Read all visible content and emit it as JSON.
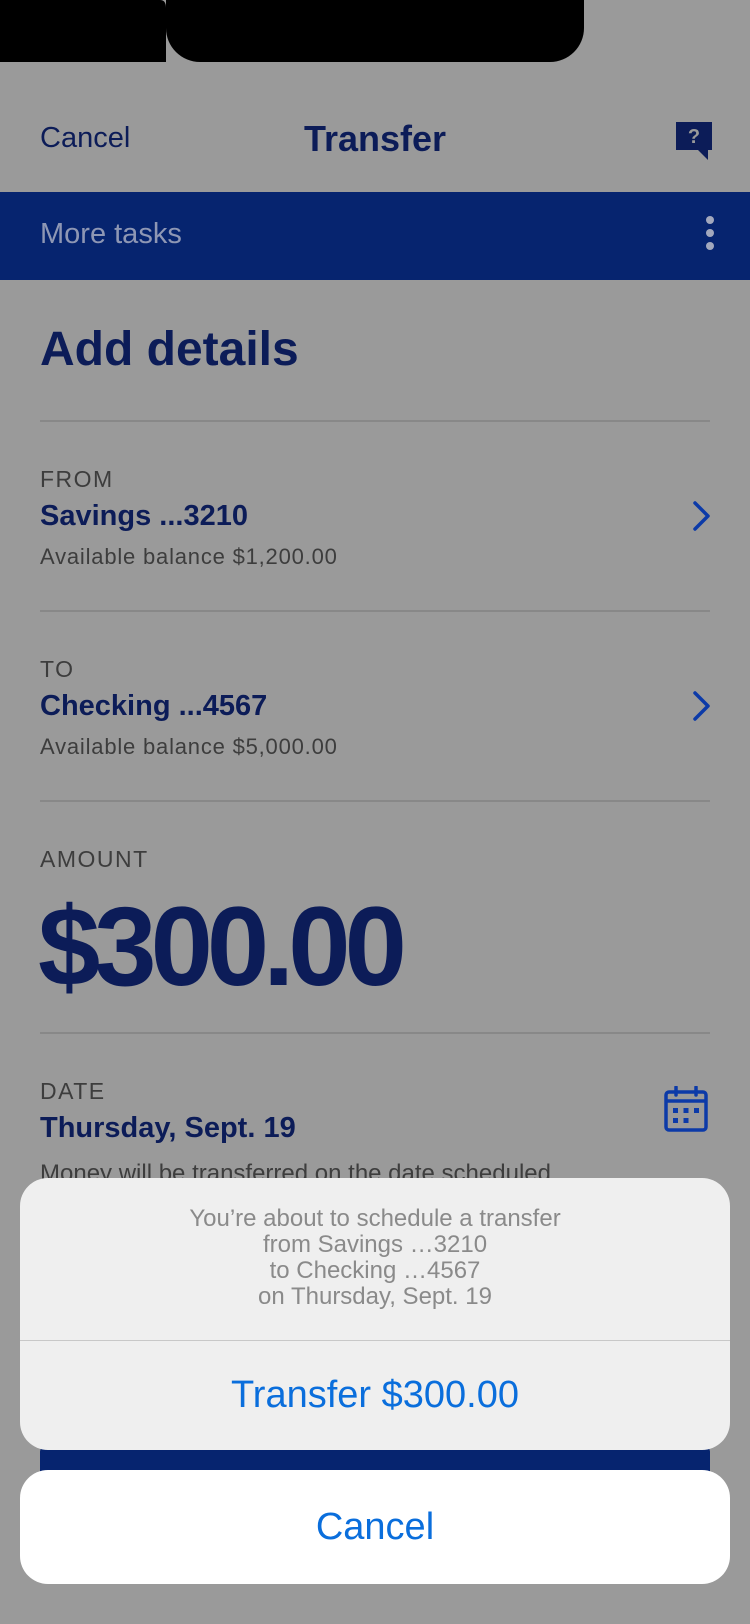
{
  "header": {
    "cancel_label": "Cancel",
    "title": "Transfer",
    "help_icon": "question-chat-icon",
    "help_glyph": "?"
  },
  "tasks_bar": {
    "label": "More tasks",
    "menu_icon": "kebab-menu-icon"
  },
  "page": {
    "title": "Add details"
  },
  "from": {
    "label": "FROM",
    "account": "Savings ...3210",
    "balance": "Available balance $1,200.00"
  },
  "to": {
    "label": "TO",
    "account": "Checking ...4567",
    "balance": "Available balance $5,000.00"
  },
  "amount": {
    "label": "AMOUNT",
    "value": "$300.00"
  },
  "date": {
    "label": "DATE",
    "value": "Thursday, Sept. 19",
    "note": "Money will be transferred on the date scheduled.",
    "icon": "calendar-icon"
  },
  "action_sheet": {
    "message_lines": [
      "You’re about to schedule a transfer",
      "from Savings …3210",
      "to Checking …4567",
      "on Thursday, Sept. 19"
    ],
    "confirm_label": "Transfer $300.00",
    "cancel_label": "Cancel"
  },
  "colors": {
    "overlay_bg": "#9a9a9a",
    "brand_navy": "#0c1c58",
    "brand_blue_bar": "#06246f",
    "ios_action_blue": "#0a6edc",
    "sheet_bg": "#efefef"
  }
}
